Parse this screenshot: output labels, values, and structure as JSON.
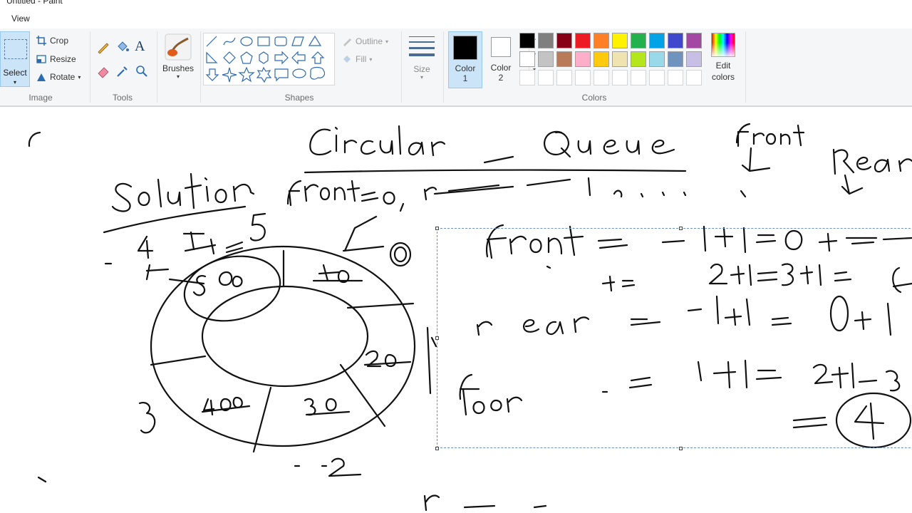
{
  "window": {
    "title": "Untitled - Paint"
  },
  "menu": {
    "view": "View"
  },
  "ribbon": {
    "image_group": {
      "label": "Image",
      "select": "Select",
      "crop": "Crop",
      "resize": "Resize",
      "rotate": "Rotate"
    },
    "tools_group": {
      "label": "Tools"
    },
    "brushes": {
      "label": "Brushes"
    },
    "shapes_group": {
      "label": "Shapes",
      "outline": "Outline",
      "fill": "Fill"
    },
    "size": {
      "label": "Size"
    },
    "colors_group": {
      "label": "Colors",
      "color1_label": "Color",
      "color1_num": "1",
      "color2_label": "Color",
      "color2_num": "2",
      "edit_label": "Edit",
      "edit_label2": "colors",
      "color1_value": "#000000",
      "color2_value": "#ffffff",
      "palette_row1": [
        "#000000",
        "#7f7f7f",
        "#880015",
        "#ed1c24",
        "#ff7f27",
        "#fff200",
        "#22b14c",
        "#00a2e8",
        "#3f48cc",
        "#a349a4"
      ],
      "palette_row2": [
        "#ffffff",
        "#c3c3c3",
        "#b97a57",
        "#ffaec9",
        "#ffc90e",
        "#efe4b0",
        "#b5e61d",
        "#99d9ea",
        "#7092be",
        "#c8bfe7"
      ]
    }
  },
  "canvas": {
    "handwriting": [
      "Circular Queue",
      "front",
      "Rear",
      "Solution",
      "front = 0,",
      "front = -1+1 = 0+1",
      "+1 = 2+1 = 3+1",
      "rear = -1+1 = 0+1",
      "= 1+1 = 2+1",
      "for",
      "4",
      "5",
      "3",
      "2",
      "0",
      "50",
      "60",
      "20",
      "30",
      "40"
    ]
  }
}
